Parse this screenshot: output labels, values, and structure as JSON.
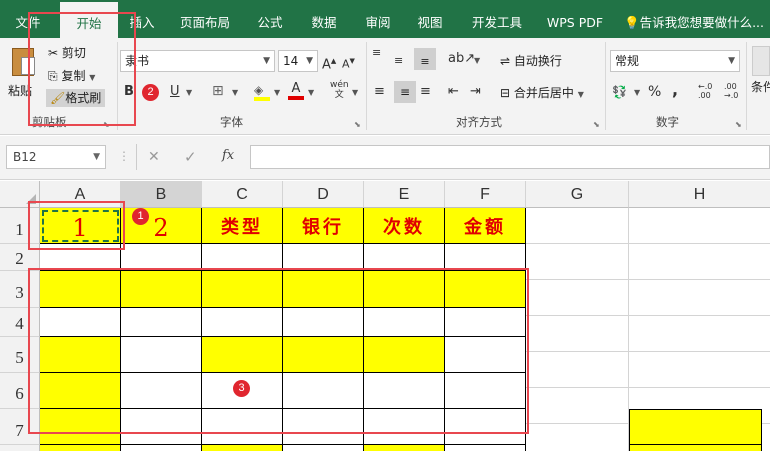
{
  "tabs": [
    "文件",
    "开始",
    "插入",
    "页面布局",
    "公式",
    "数据",
    "审阅",
    "视图",
    "开发工具",
    "WPS PDF"
  ],
  "tell_me": "告诉我您想要做什么...",
  "clipboard": {
    "paste": "粘贴",
    "cut": "剪切",
    "copy": "复制",
    "format_painter": "格式刷",
    "group": "剪贴板"
  },
  "font": {
    "name": "隶书",
    "size": "14",
    "bold": "B",
    "underline": "U",
    "font_color_letter": "A",
    "phonetic": "wén",
    "group": "字体"
  },
  "alignment": {
    "wrap": "自动换行",
    "merge": "合并后居中",
    "group": "对齐方式"
  },
  "number": {
    "format": "常规",
    "percent": "%",
    "comma": ",",
    "inc": ".00",
    "dec": ".0",
    "group": "数字"
  },
  "styles": {
    "cond": "条件"
  },
  "formula_bar": {
    "name_box": "B12",
    "cancel": "✕",
    "enter": "✓",
    "fx": "fx",
    "value": ""
  },
  "columns": [
    "A",
    "B",
    "C",
    "D",
    "E",
    "F",
    "G",
    "H"
  ],
  "rows": [
    "1",
    "2",
    "3",
    "4",
    "5",
    "6",
    "7"
  ],
  "cells": {
    "A1": "1",
    "B1": "2",
    "C1": "类型",
    "D1": "银行",
    "E1": "次数",
    "F1": "金额"
  },
  "badges": [
    "1",
    "2",
    "3"
  ],
  "colors": {
    "ribbon_green": "#217346",
    "fill_yellow": "#ffff00",
    "annotation_red": "#e8474f",
    "text_red": "#e00000"
  }
}
